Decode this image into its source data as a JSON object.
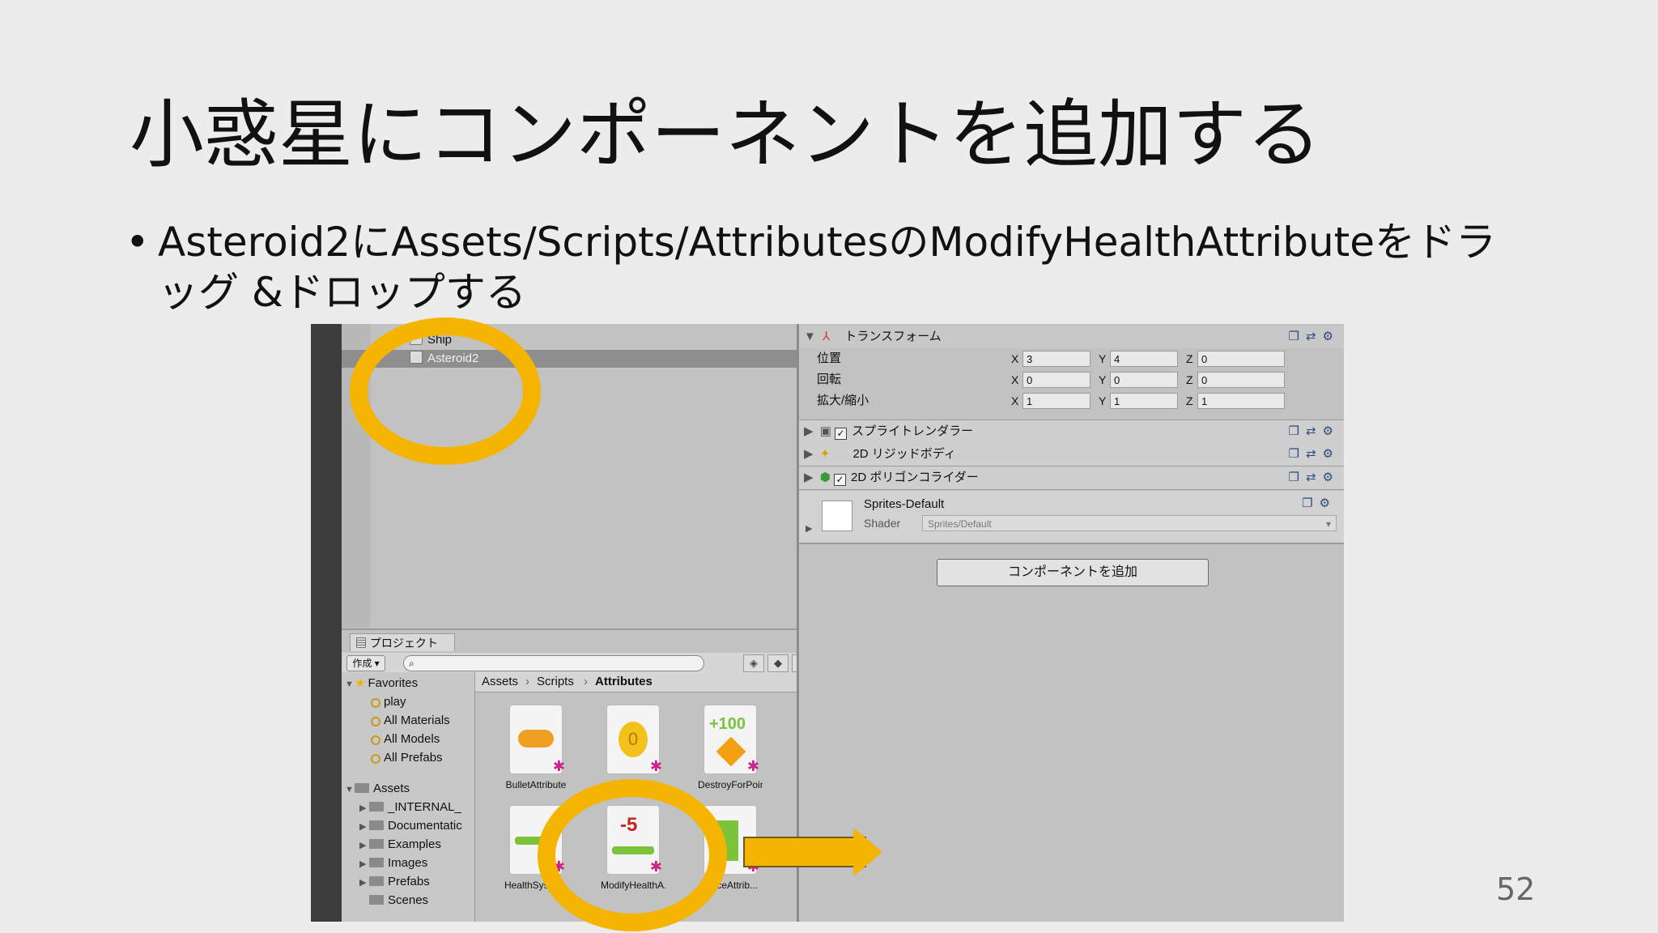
{
  "slide": {
    "title": "小惑星にコンポーネントを追加する",
    "bullet": "Asteroid2にAssets/Scripts/AttributesのModifyHealthAttributeをドラッグ &ドロップする",
    "page_number": "52"
  },
  "hierarchy": {
    "items": [
      "Ship",
      "Asteroid2"
    ],
    "selected": "Asteroid2"
  },
  "project": {
    "tab_label": "プロジェクト",
    "create_label": "作成 ▾",
    "favorites_label": "Favorites",
    "favorites": [
      "play",
      "All Materials",
      "All Models",
      "All Prefabs"
    ],
    "assets_label": "Assets",
    "asset_folders": [
      "_INTERNAL_",
      "Documentatic",
      "Examples",
      "Images",
      "Prefabs",
      "Scenes"
    ],
    "breadcrumb": [
      "Assets",
      "Scripts",
      "Attributes"
    ],
    "files": [
      "BulletAttribute",
      "DestroyForPoin...",
      "HealthSyster...",
      "ModifyHealthA...",
      "ourceAttrib..."
    ],
    "coin_label": "0",
    "plus_label": "+100",
    "minus_label": "-5"
  },
  "inspector": {
    "transform_label": "トランスフォーム",
    "position_label": "位置",
    "rotation_label": "回転",
    "scale_label": "拡大/縮小",
    "axis_x": "X",
    "axis_y": "Y",
    "axis_z": "Z",
    "position": {
      "x": "3",
      "y": "4",
      "z": "0"
    },
    "rotation": {
      "x": "0",
      "y": "0",
      "z": "0"
    },
    "scale": {
      "x": "1",
      "y": "1",
      "z": "1"
    },
    "sprite_renderer_label": "スプライトレンダラー",
    "rigidbody_label": "2D リジッドボディ",
    "collider_label": "2D ポリゴンコライダー",
    "material_name": "Sprites-Default",
    "shader_label": "Shader",
    "shader_value": "Sprites/Default",
    "add_component_label": "コンポーネントを追加"
  },
  "colors": {
    "highlight": "#f4b400"
  }
}
